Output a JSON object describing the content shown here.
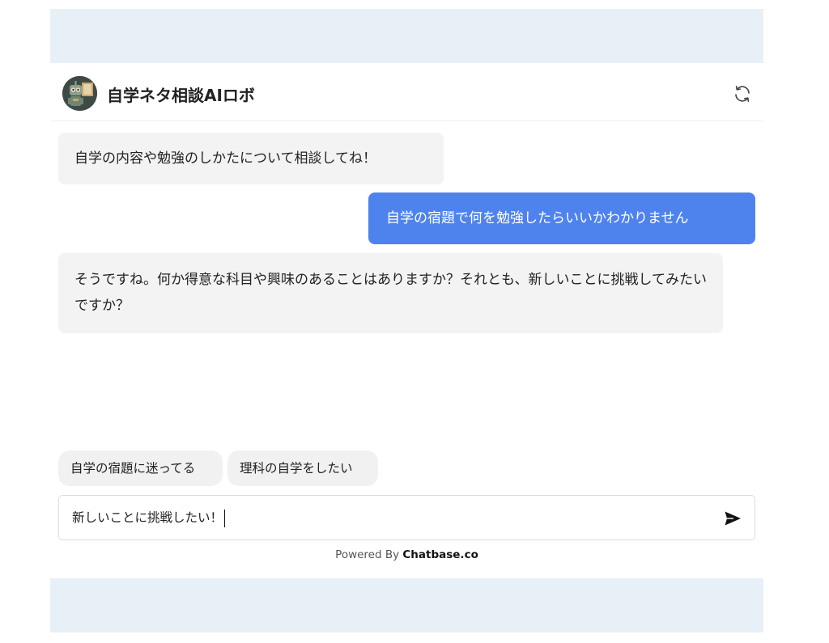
{
  "header": {
    "title": "自学ネタ相談AIロボ",
    "avatar_icon": "robot-icon",
    "refresh_icon": "refresh-icon"
  },
  "messages": [
    {
      "role": "bot",
      "text": "自学の内容や勉強のしかたについて相談してね！"
    },
    {
      "role": "user",
      "text": "自学の宿題で何を勉強したらいいかわかりません"
    },
    {
      "role": "bot",
      "text": "そうですね。何か得意な科目や興味のあることはありますか？それとも、新しいことに挑戦してみたいですか？"
    }
  ],
  "suggestions": [
    "自学の宿題に迷ってる",
    "理科の自学をしたい"
  ],
  "composer": {
    "value": "新しいことに挑戦したい！",
    "send_icon": "send-icon"
  },
  "footer": {
    "prefix": "Powered By ",
    "brand": "Chatbase.co"
  },
  "colors": {
    "band": "#e8f0f7",
    "user_bubble": "#4e83ee",
    "bot_bubble": "#f3f3f3",
    "suggestion_bg": "#f1f1f1"
  }
}
